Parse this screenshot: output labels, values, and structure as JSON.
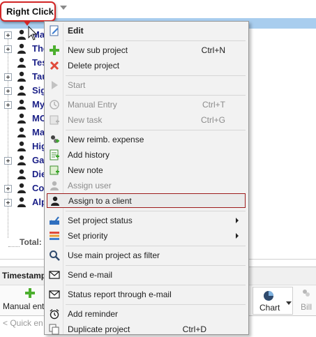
{
  "callout": {
    "label": "Right Click"
  },
  "tree": {
    "items": [
      {
        "label": "Marke"
      },
      {
        "label": "The"
      },
      {
        "label": "Tes"
      },
      {
        "label": "Tau"
      },
      {
        "label": "Sig"
      },
      {
        "label": "My"
      },
      {
        "label": "MO"
      },
      {
        "label": "Ma"
      },
      {
        "label": "Hig"
      },
      {
        "label": "Gar"
      },
      {
        "label": "Die"
      },
      {
        "label": "Cor"
      },
      {
        "label": "Alp"
      }
    ],
    "total_label": "Total:"
  },
  "bottom": {
    "tab_label": "Timestamp",
    "manual_entry_label": "Manual ent",
    "chart_label": "Chart",
    "bill_label": "Bill",
    "quick_placeholder": "< Quick en"
  },
  "menu": {
    "items": [
      {
        "label": "Edit",
        "icon": "edit-icon"
      },
      {
        "label": "New sub project",
        "shortcut": "Ctrl+N",
        "icon": "plus-icon"
      },
      {
        "label": "Delete project",
        "icon": "delete-icon"
      },
      {
        "label": "Start",
        "icon": "play-icon"
      },
      {
        "label": "Manual Entry",
        "shortcut": "Ctrl+T",
        "icon": "clock-icon"
      },
      {
        "label": "New task",
        "shortcut": "Ctrl+G",
        "icon": "task-icon"
      },
      {
        "label": "New reimb. expense",
        "icon": "expense-icon"
      },
      {
        "label": "Add history",
        "icon": "history-icon"
      },
      {
        "label": "New note",
        "icon": "note-icon"
      },
      {
        "label": "Assign user",
        "icon": "user-icon"
      },
      {
        "label": "Assign to a client",
        "icon": "client-icon"
      },
      {
        "label": "Set project status",
        "icon": "status-icon"
      },
      {
        "label": "Set priority",
        "icon": "priority-icon"
      },
      {
        "label": "Use main project as filter",
        "icon": "magnifier-icon"
      },
      {
        "label": "Send e-mail",
        "icon": "mail-icon"
      },
      {
        "label": "Status report through e-mail",
        "icon": "mail-icon"
      },
      {
        "label": "Add reminder",
        "icon": "alarm-icon"
      },
      {
        "label": "Duplicate project",
        "shortcut": "Ctrl+D",
        "icon": "duplicate-icon"
      }
    ]
  },
  "colors": {
    "highlight_border": "#9d1b1b",
    "callout_border": "#d22626",
    "tree_text": "#1a1f87",
    "header_bar": "#a8cdee"
  }
}
